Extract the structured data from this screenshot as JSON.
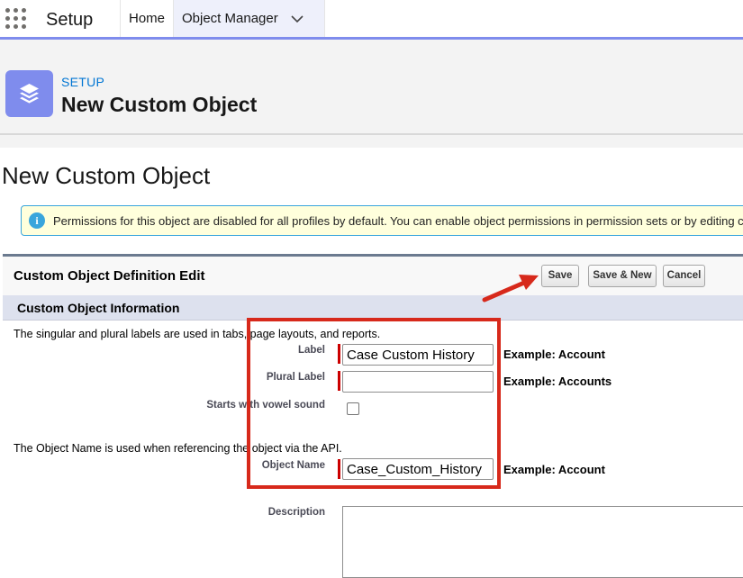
{
  "nav": {
    "app_name": "Setup",
    "tabs": [
      {
        "label": "Home"
      },
      {
        "label": "Object Manager"
      }
    ]
  },
  "header": {
    "breadcrumb": "SETUP",
    "title": "New Custom Object",
    "icon": "stacked-layers-icon"
  },
  "page_title": "New Custom Object",
  "info_banner": {
    "icon": "info-icon",
    "icon_glyph": "i",
    "text": "Permissions for this object are disabled for all profiles by default. You can enable object permissions in permission sets or by editing c"
  },
  "panel": {
    "title": "Custom Object Definition Edit",
    "buttons": {
      "save": "Save",
      "save_new": "Save & New",
      "cancel": "Cancel"
    },
    "section_title": "Custom Object Information",
    "help_labels": "The singular and plural labels are used in tabs, page layouts, and reports.",
    "help_api": "The Object Name is used when referencing the object via the API.",
    "fields": {
      "label": {
        "label": "Label",
        "value": "Case Custom History",
        "example": "Example:  Account"
      },
      "plural_label": {
        "label": "Plural Label",
        "value": "",
        "example": "Example:  Accounts"
      },
      "vowel": {
        "label": "Starts with vowel sound",
        "checked": false
      },
      "object_name": {
        "label": "Object Name",
        "value": "Case_Custom_History",
        "example": "Example:  Account"
      },
      "description": {
        "label": "Description",
        "value": ""
      }
    }
  },
  "colors": {
    "accent": "#7f8ced",
    "link": "#0176d3",
    "annotation": "#d7291b",
    "banner_bg": "#ffffdc"
  }
}
